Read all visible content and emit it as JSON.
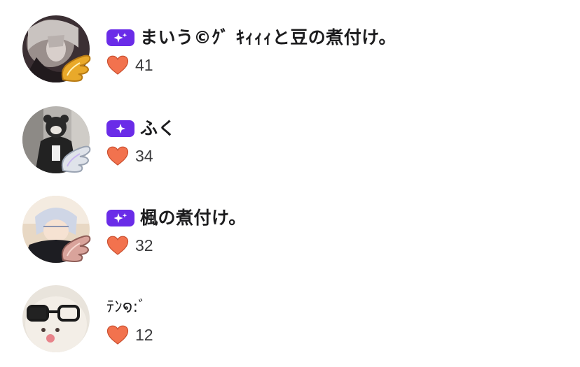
{
  "colors": {
    "badge": "#6a2ce8",
    "heart": "#f2724e",
    "text": "#1c1c1e",
    "count_text": "#3a3a3c",
    "background": "#ffffff"
  },
  "icons": {
    "badge": "sparkle-icon",
    "like": "heart-icon",
    "frame": "wing-frame-icon"
  },
  "users": [
    {
      "name": "まいう©ｸﾞ ｷｨｨｨと豆の煮付け。",
      "likes": "41",
      "premium": true,
      "wing": "gold"
    },
    {
      "name": "ふく",
      "likes": "34",
      "premium": true,
      "wing": "silver"
    },
    {
      "name": "楓の煮付け。",
      "likes": "32",
      "premium": true,
      "wing": "rose"
    },
    {
      "name": "ﾃﾝ໑:ﾞ",
      "likes": "12",
      "premium": false,
      "wing": "none"
    }
  ]
}
